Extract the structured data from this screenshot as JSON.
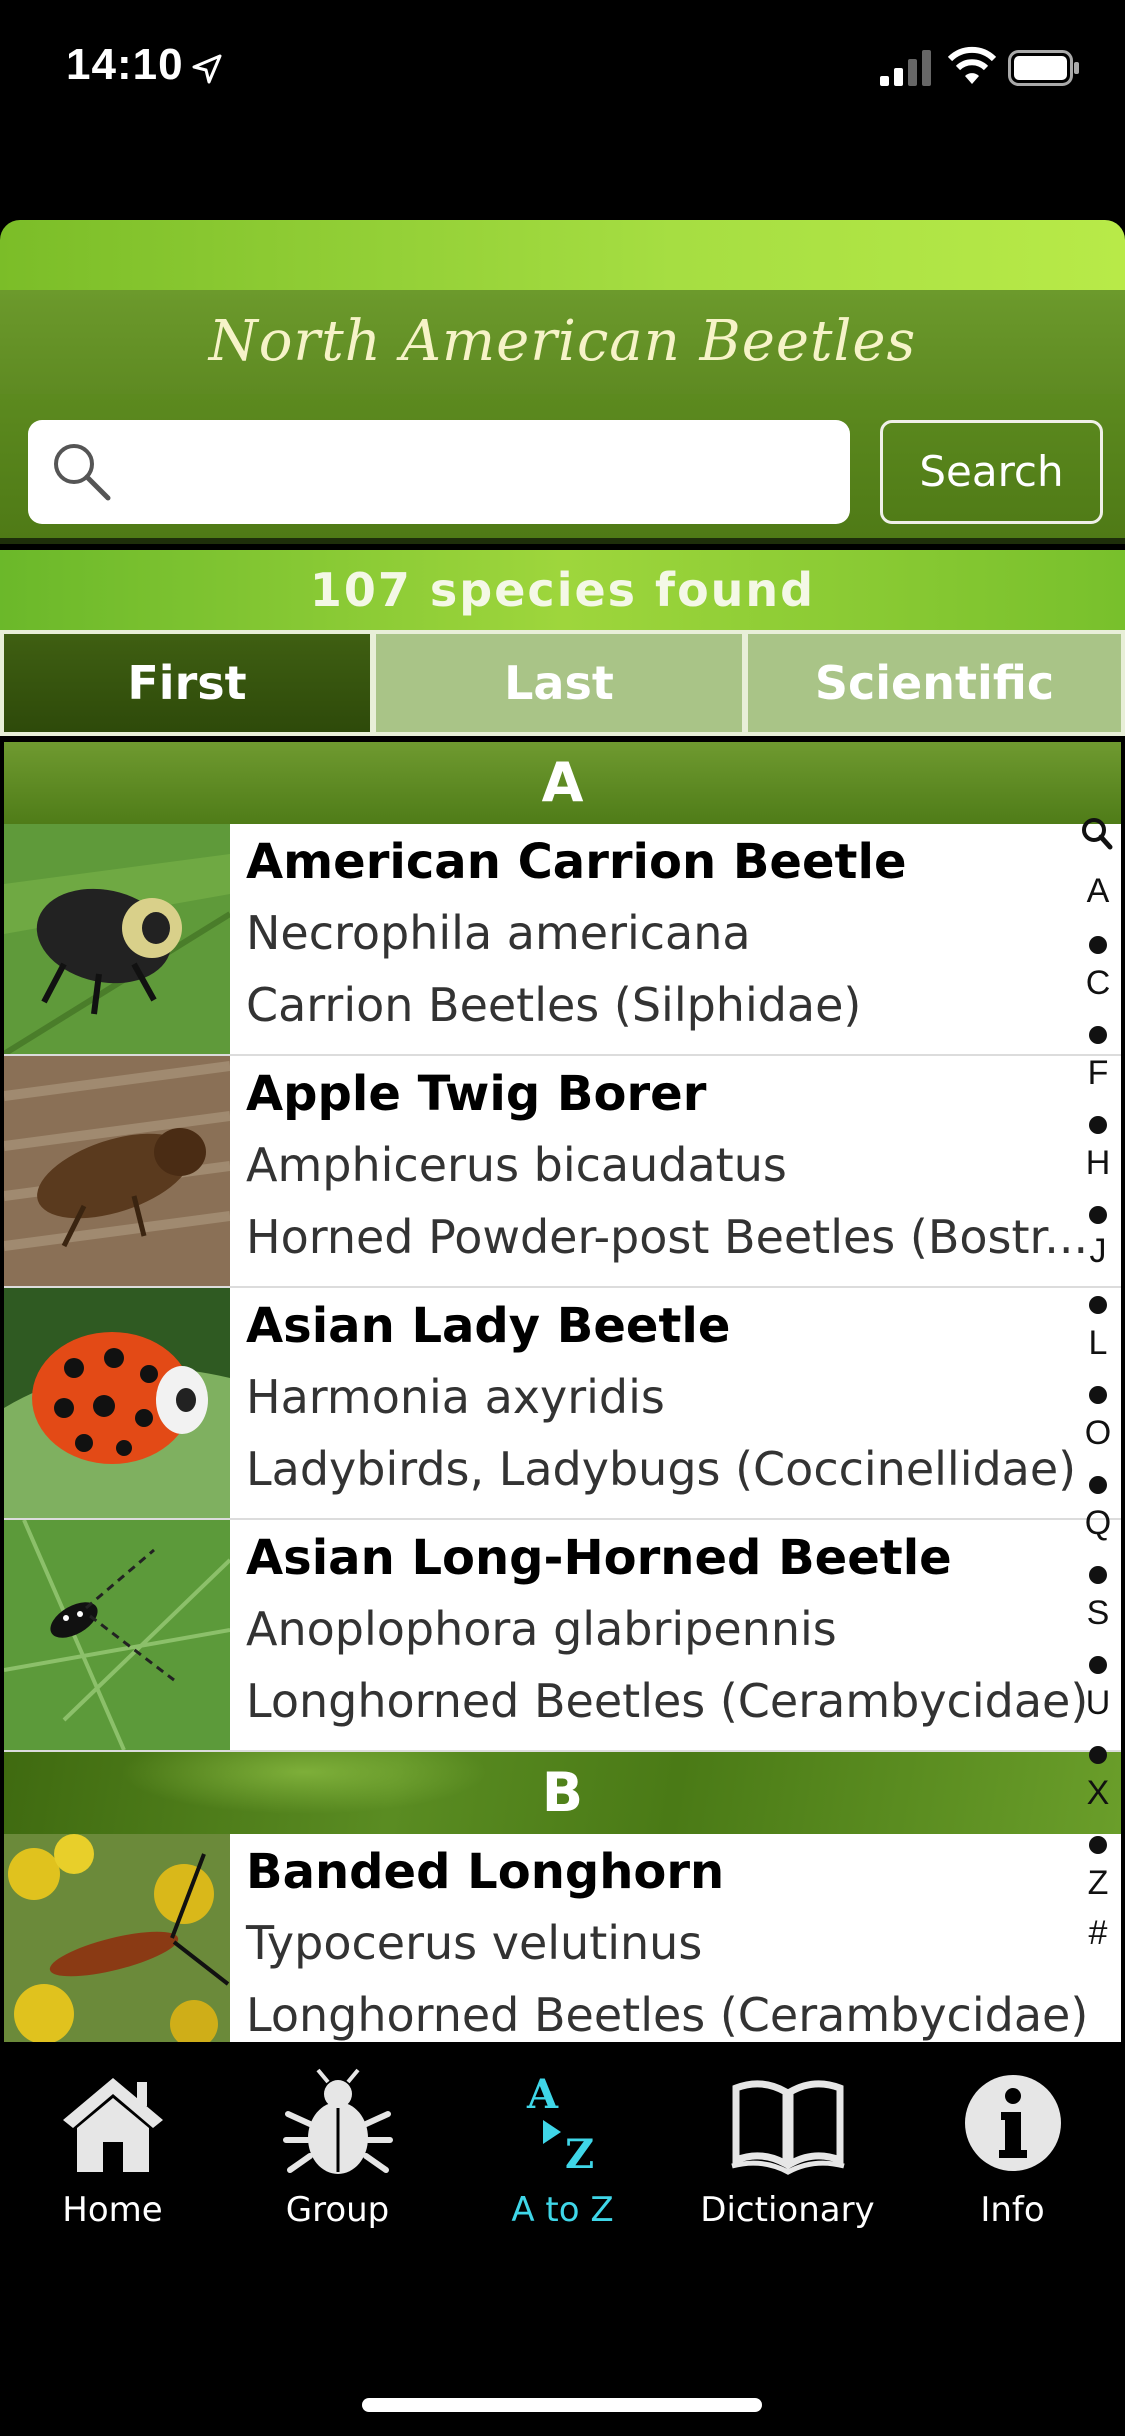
{
  "status_bar": {
    "time": "14:10"
  },
  "header": {
    "title": "North American Beetles"
  },
  "search": {
    "placeholder": "",
    "value": "",
    "button_label": "Search"
  },
  "result_count": "107 species found",
  "sort_tabs": [
    {
      "label": "First",
      "selected": true
    },
    {
      "label": "Last",
      "selected": false
    },
    {
      "label": "Scientific",
      "selected": false
    }
  ],
  "sections": [
    {
      "letter": "A",
      "items": [
        {
          "common": "American Carrion Beetle",
          "scientific": "Necrophila americana",
          "family": "Carrion Beetles (Silphidae)"
        },
        {
          "common": "Apple Twig Borer",
          "scientific": "Amphicerus bicaudatus",
          "family": "Horned Powder-post Beetles (Bostr..."
        },
        {
          "common": "Asian Lady Beetle",
          "scientific": "Harmonia axyridis",
          "family": "Ladybirds, Ladybugs (Coccinellidae)"
        },
        {
          "common": "Asian Long-Horned Beetle",
          "scientific": "Anoplophora glabripennis",
          "family": "Longhorned Beetles (Cerambycidae)"
        }
      ]
    },
    {
      "letter": "B",
      "items": [
        {
          "common": "Banded Longhorn",
          "scientific": "Typocerus velutinus",
          "family": "Longhorned Beetles (Cerambycidae)"
        }
      ]
    }
  ],
  "index_letters": [
    "search",
    "A",
    "•",
    "C",
    "•",
    "F",
    "•",
    "H",
    "•",
    "J",
    "•",
    "L",
    "•",
    "O",
    "•",
    "Q",
    "•",
    "S",
    "•",
    "U",
    "•",
    "X",
    "•",
    "Z",
    "#"
  ],
  "tab_bar": [
    {
      "label": "Home",
      "icon": "house-icon",
      "active": false
    },
    {
      "label": "Group",
      "icon": "beetle-icon",
      "active": false
    },
    {
      "label": "A to Z",
      "icon": "a-to-z-icon",
      "active": true
    },
    {
      "label": "Dictionary",
      "icon": "book-icon",
      "active": false
    },
    {
      "label": "Info",
      "icon": "info-icon",
      "active": false
    }
  ],
  "colors": {
    "accent_active": "#3fd6e8",
    "header_green": "#5e8a22",
    "bright_green": "#9ed63c"
  }
}
